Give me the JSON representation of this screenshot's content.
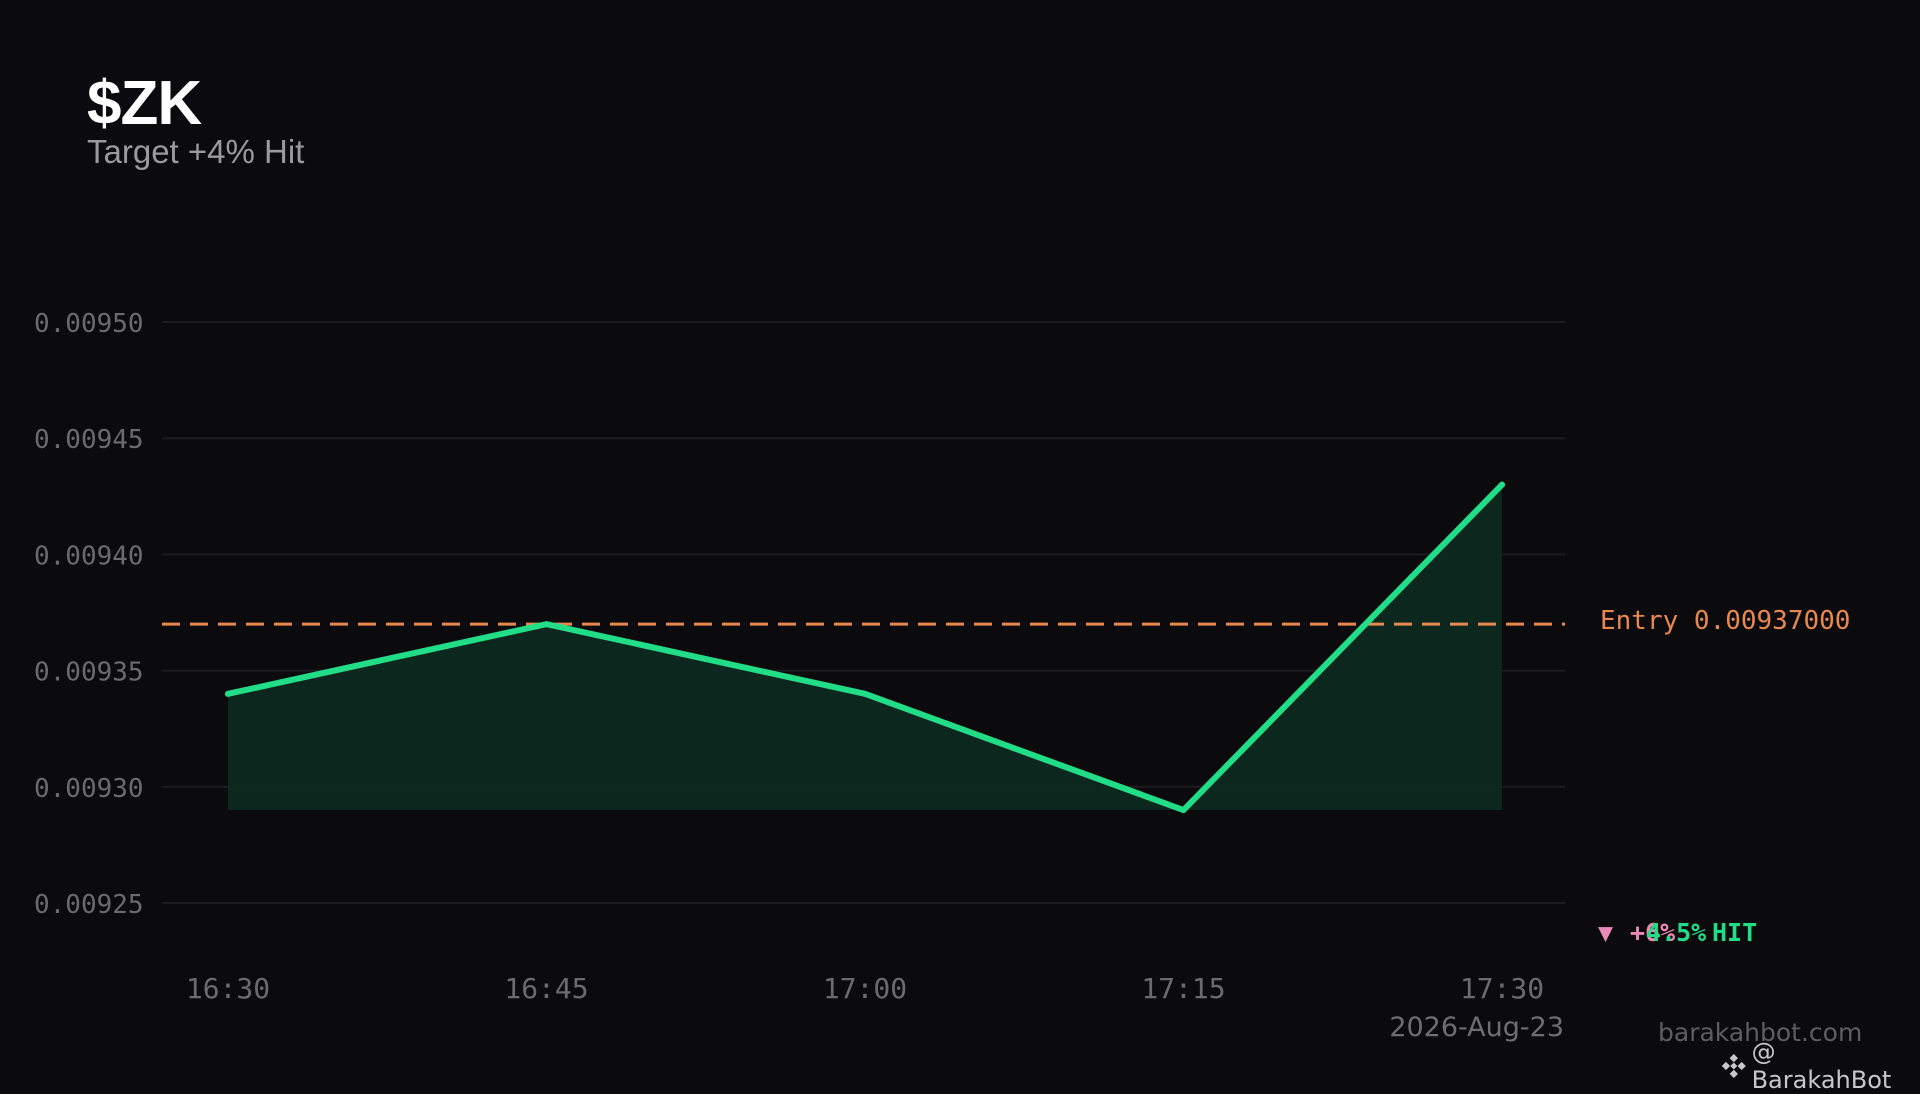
{
  "header": {
    "title": "$ZK",
    "subtitle": "Target +4% Hit"
  },
  "entry": {
    "label": "Entry 0.00937000",
    "value": 0.00937
  },
  "status": {
    "arrow": "▼",
    "pct_overlap_a": "+6%",
    "pct_overlap_b": "4.5%",
    "hit": "HIT"
  },
  "date": "2026-Aug-23",
  "watermark": {
    "site": "barakahbot.com",
    "handle": "@ BarakahBot",
    "icon": "binance-diamond-icon"
  },
  "colors": {
    "background": "#0b0b0d",
    "line": "#22dd88",
    "fill": "#0d2a20",
    "entry": "#e8884f",
    "grid": "#1d1d21",
    "negative": "#e98ab6"
  },
  "chart_data": {
    "type": "area",
    "x": [
      "16:30",
      "16:45",
      "17:00",
      "17:15",
      "17:30"
    ],
    "y": [
      0.00934,
      0.00937,
      0.00934,
      0.00929,
      0.00943
    ],
    "ylim": [
      0.00925,
      0.0095
    ],
    "yticks": [
      "0.00925",
      "0.00930",
      "0.00935",
      "0.00940",
      "0.00945",
      "0.00950"
    ],
    "baseline": 0.00929,
    "reference_line": 0.00937,
    "grid": true
  }
}
